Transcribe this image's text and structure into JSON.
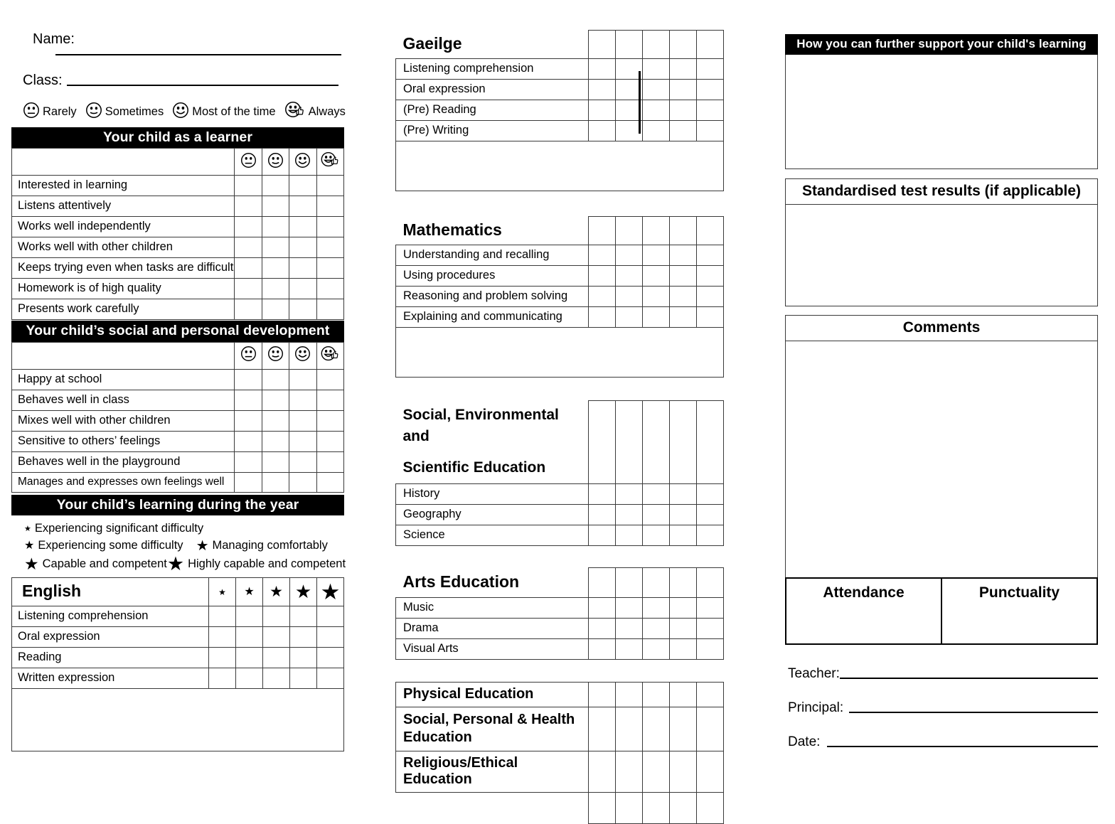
{
  "header": {
    "name_label": "Name:",
    "class_label": "Class:"
  },
  "face_legend": [
    {
      "icon": "neutral-face-icon",
      "label": "Rarely"
    },
    {
      "icon": "slight-smile-face-icon",
      "label": "Sometimes"
    },
    {
      "icon": "smile-face-icon",
      "label": "Most of the time"
    },
    {
      "icon": "smile-thumbs-up-face-icon",
      "label": "Always"
    }
  ],
  "learner": {
    "title": "Your child as a learner",
    "rows": [
      "Interested in learning",
      "Listens attentively",
      "Works well independently",
      "Works well with other children",
      "Keeps trying even when tasks are difficult",
      "Homework is of high quality",
      "Presents work carefully"
    ]
  },
  "social": {
    "title": "Your child’s social and personal development",
    "rows": [
      "Happy at school",
      "Behaves well in class",
      "Mixes well with other children",
      "Sensitive to others’ feelings",
      "Behaves well in the playground",
      "Manages and expresses own feelings well"
    ]
  },
  "learning_year": {
    "title": "Your child’s learning during the year",
    "star_legend": [
      {
        "size": 1,
        "label": "Experiencing significant difficulty"
      },
      {
        "size": 2,
        "label": "Experiencing some difficulty"
      },
      {
        "size": 3,
        "label": "Managing comfortably"
      },
      {
        "size": 4,
        "label": "Capable and competent"
      },
      {
        "size": 5,
        "label": "Highly capable and competent"
      }
    ]
  },
  "english": {
    "title": "English",
    "rows": [
      "Listening comprehension",
      "Oral expression",
      "Reading",
      "Written expression"
    ]
  },
  "gaeilge": {
    "title": "Gaeilge",
    "rows": [
      "Listening comprehension",
      "Oral expression",
      "(Pre) Reading",
      "(Pre) Writing"
    ]
  },
  "mathematics": {
    "title": "Mathematics",
    "rows": [
      "Understanding and recalling",
      "Using procedures",
      "Reasoning and problem solving",
      "Explaining and communicating"
    ]
  },
  "sese": {
    "title_line1": "Social, Environmental and",
    "title_line2": "Scientific Education",
    "rows": [
      "History",
      "Geography",
      "Science"
    ]
  },
  "arts": {
    "title": "Arts Education",
    "rows": [
      "Music",
      "Drama",
      "Visual Arts"
    ]
  },
  "other_subjects": {
    "rows": [
      "Physical Education",
      "Social, Personal & Health Education",
      "Religious/Ethical Education"
    ]
  },
  "support": {
    "title": "How you can further support your child's learning"
  },
  "standardised": {
    "title": "Standardised test results (if applicable)"
  },
  "comments": {
    "title": "Comments"
  },
  "attendance": {
    "attendance_label": "Attendance",
    "punctuality_label": "Punctuality"
  },
  "signatures": [
    {
      "label": "Teacher:"
    },
    {
      "label": "Principal:"
    },
    {
      "label": "Date:"
    }
  ]
}
